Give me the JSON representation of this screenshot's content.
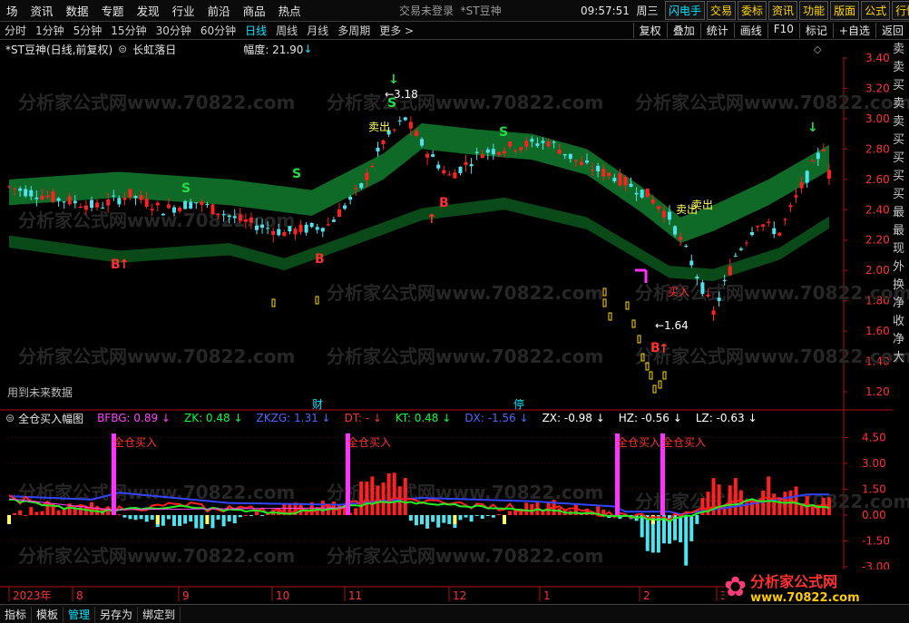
{
  "menubar": {
    "items": [
      "场",
      "资讯",
      "数据",
      "专题",
      "发现",
      "行业",
      "前沿",
      "商品",
      "热点"
    ],
    "login": "交易未登录",
    "stock": "*ST豆神",
    "time": "09:57:51",
    "weekday": "周三",
    "buttons": [
      "闪电手",
      "交易",
      "委标",
      "资讯",
      "功能",
      "版面",
      "公式",
      "行情"
    ]
  },
  "periodbar": {
    "periods": [
      "分时",
      "1分钟",
      "5分钟",
      "15分钟",
      "30分钟",
      "60分钟",
      "日线",
      "周线",
      "月线",
      "多周期",
      "更多 >"
    ],
    "active_index": 6,
    "right_buttons": [
      "复权",
      "叠加",
      "统计",
      "画线",
      "F10",
      "标记",
      "+自选",
      "返回"
    ]
  },
  "main_header": {
    "title": "*ST豆神(日线,前复权)",
    "dropdown_icon": "circle-chevron-icon",
    "indicator": "长虹落日",
    "amplitude": "幅度: 21.90"
  },
  "sub_header": {
    "name": "全仓买入幅图",
    "values": [
      {
        "label": "BFBG: 0.89",
        "color": "#ff44ff"
      },
      {
        "label": "ZK: 0.48",
        "color": "#00ff44"
      },
      {
        "label": "ZKZG: 1.31",
        "color": "#4d66ff"
      },
      {
        "label": "DT: -",
        "color": "#ff3333"
      },
      {
        "label": "KT: 0.48",
        "color": "#00ff44"
      },
      {
        "label": "DX: -1.56",
        "color": "#4d66ff"
      },
      {
        "label": "ZX: -0.98",
        "color": "#ffffff"
      },
      {
        "label": "HZ: -0.56",
        "color": "#ffffff"
      },
      {
        "label": "LZ: -0.63",
        "color": "#ffffff"
      }
    ]
  },
  "main_chart": {
    "y_ticks": [
      "3.40",
      "3.20",
      "3.00",
      "2.80",
      "2.60",
      "2.40",
      "2.20",
      "2.00",
      "1.80",
      "1.60",
      "1.40",
      "1.20"
    ],
    "high_label": "3.18",
    "low_label": "1.64",
    "future_data": "用到未来数据",
    "markers": [
      "财",
      "停"
    ],
    "signal_labels": [
      "S",
      "B",
      "买入",
      "卖出",
      "卖出",
      "卖出"
    ]
  },
  "sub_chart": {
    "y_ticks": [
      "4.50",
      "3.00",
      "1.50",
      "0.00",
      "-1.50",
      "-3.00"
    ],
    "buy_label": "全仓买入"
  },
  "x_axis": {
    "labels": [
      "2023年",
      "8",
      "9",
      "10",
      "11",
      "12",
      "1",
      "2",
      "3"
    ]
  },
  "right_strip": [
    "卖",
    "卖",
    "买",
    "卖",
    "卖",
    "买",
    "买",
    "买",
    "买",
    "最",
    "最",
    "现",
    "外",
    "换",
    "净",
    "收",
    "净",
    "大"
  ],
  "bottombar": {
    "items": [
      "指标",
      "模板",
      "管理",
      "另存为",
      "绑定到"
    ],
    "active_index": 2
  },
  "watermark": "分析家公式网www.70822.com",
  "logo": {
    "line1": "分析家公式网",
    "line2": "www.70822.com"
  },
  "colors": {
    "up": "#ff2020",
    "down": "#4fe3f0",
    "band_upper": "#0e6a26",
    "band_lower": "#0a4a18",
    "magenta": "#ff33ff"
  }
}
